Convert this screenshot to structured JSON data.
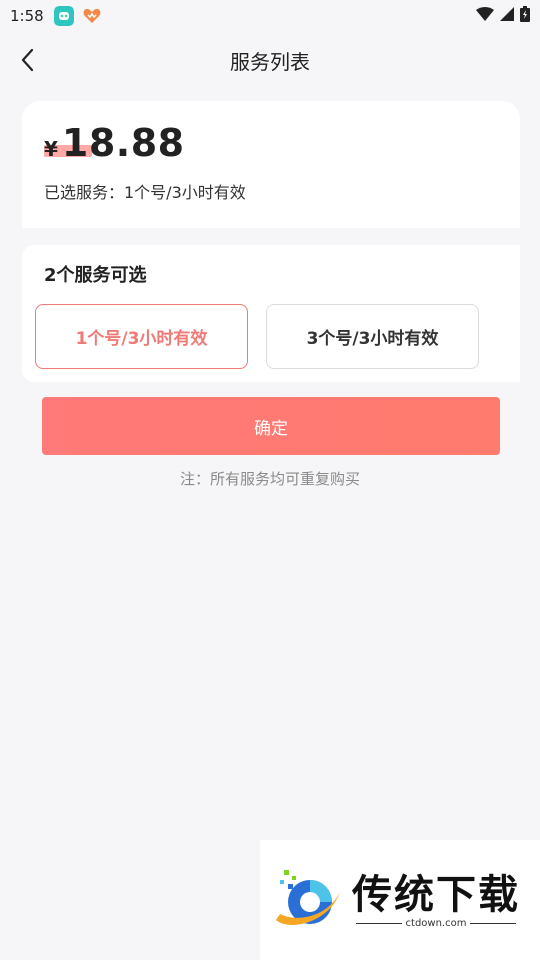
{
  "status_bar": {
    "time": "1:58",
    "icons": [
      "app-notification-icon",
      "heart-app-icon",
      "wifi-icon",
      "signal-icon",
      "battery-icon"
    ]
  },
  "nav": {
    "title": "服务列表",
    "back_icon": "chevron-left-icon"
  },
  "price_card": {
    "currency": "¥",
    "amount": "18.88",
    "selected_label": "已选服务：1个号/3小时有效"
  },
  "options": {
    "title": "2个服务可选",
    "items": [
      {
        "label": "1个号/3小时有效",
        "selected": true
      },
      {
        "label": "3个号/3小时有效",
        "selected": false
      }
    ]
  },
  "confirm": {
    "label": "确定"
  },
  "note": "注：所有服务均可重复购买",
  "watermark": {
    "title": "传统下载",
    "url": "ctdown.com"
  },
  "colors": {
    "accent": "#ff7a78",
    "selected_border": "#f07a76",
    "background": "#f6f6f8",
    "card": "#ffffff"
  }
}
